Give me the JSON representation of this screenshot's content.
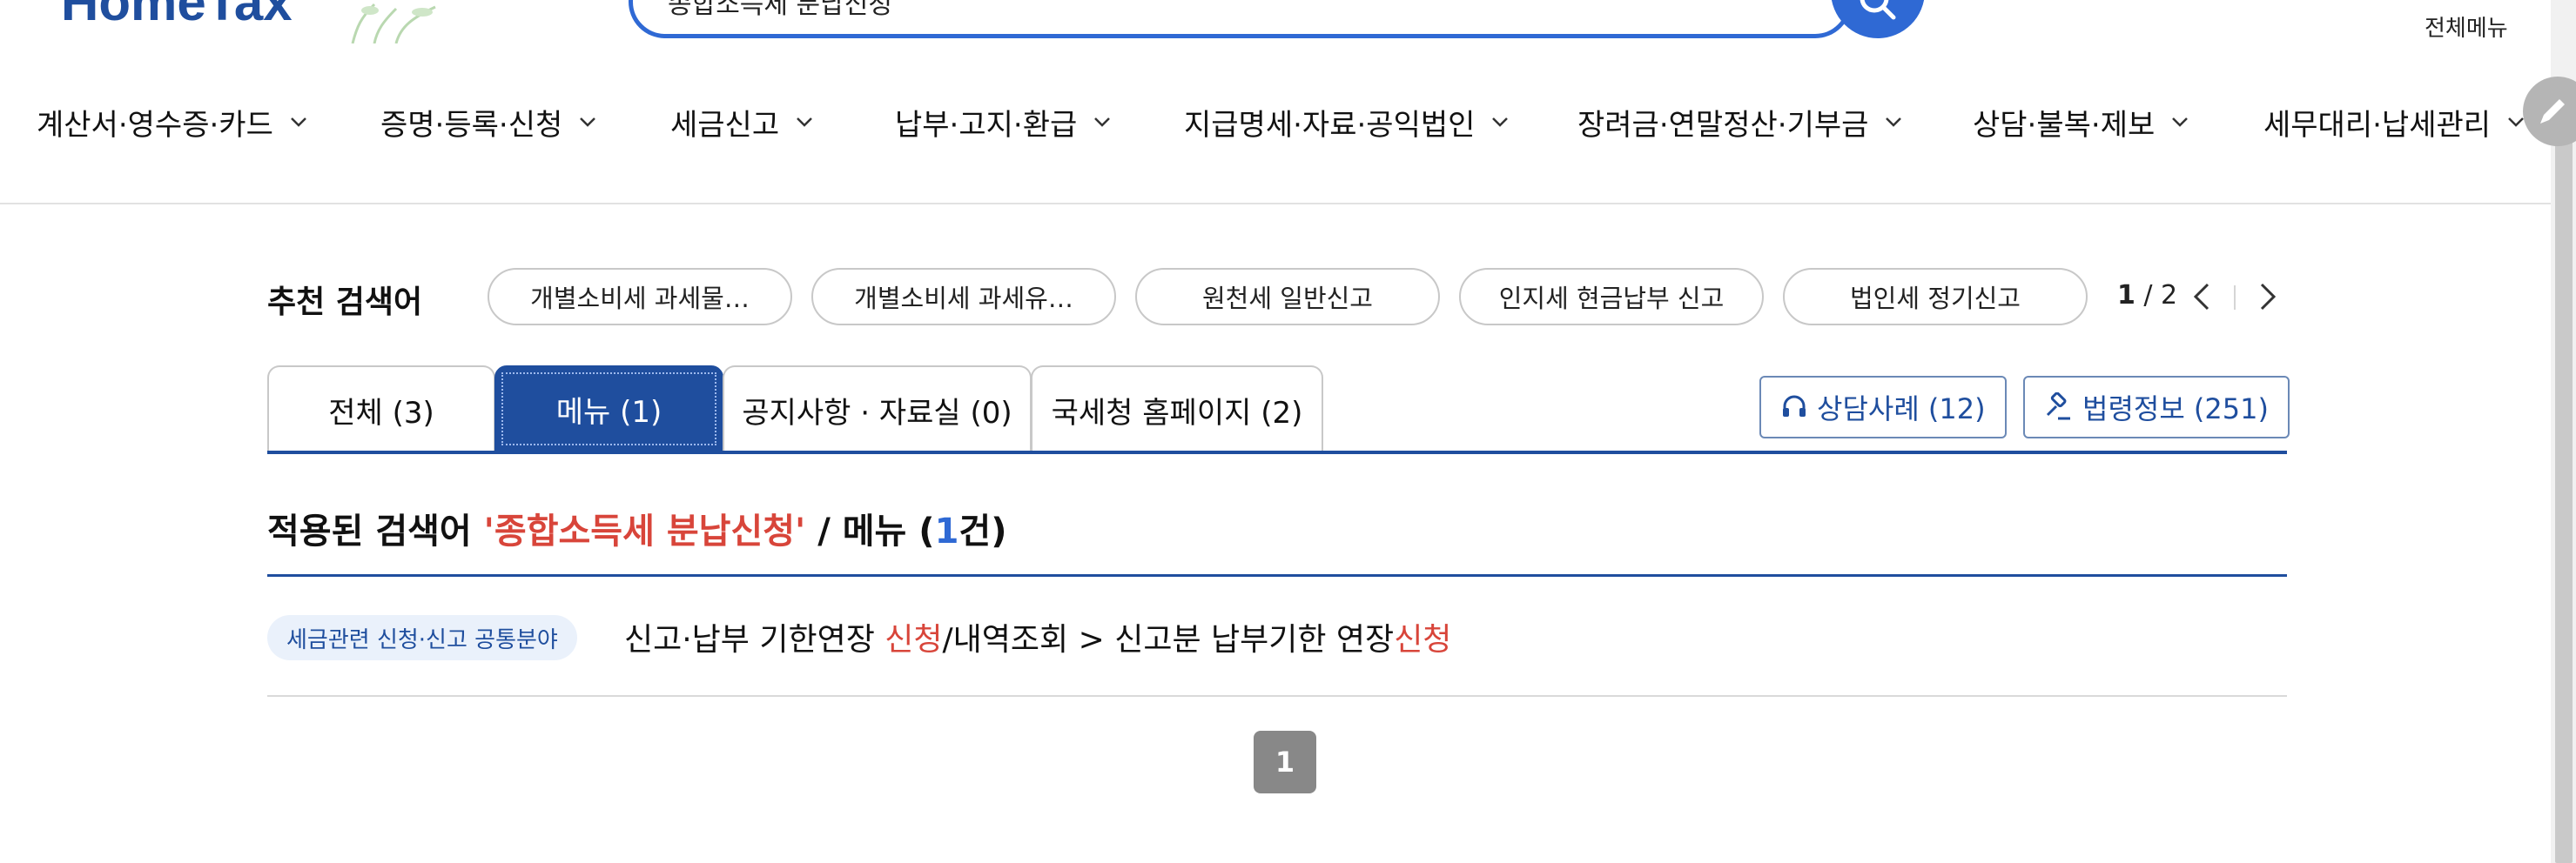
{
  "header": {
    "logo": "HomeTax",
    "search_value": "종합소득세 분납신청",
    "all_menu_label": "전체메뉴"
  },
  "gnb": {
    "items": [
      {
        "label": "계산서·영수증·카드"
      },
      {
        "label": "증명·등록·신청"
      },
      {
        "label": "세금신고"
      },
      {
        "label": "납부·고지·환급"
      },
      {
        "label": "지급명세·자료·공익법인"
      },
      {
        "label": "장려금·연말정산·기부금"
      },
      {
        "label": "상담·불복·제보"
      },
      {
        "label": "세무대리·납세관리"
      }
    ]
  },
  "recommended": {
    "title": "추천 검색어",
    "chips": [
      {
        "label": "개별소비세 과세물…"
      },
      {
        "label": "개별소비세 과세유…"
      },
      {
        "label": "원천세 일반신고"
      },
      {
        "label": "인지세 현금납부 신고"
      },
      {
        "label": "법인세 정기신고"
      }
    ],
    "page_current": "1",
    "page_total": " / 2"
  },
  "tabs": [
    {
      "label": "전체 (3)",
      "active": false
    },
    {
      "label": "메뉴 (1)",
      "active": true
    },
    {
      "label": "공지사항 · 자료실 (0)",
      "active": false
    },
    {
      "label": "국세청 홈페이지 (2)",
      "active": false
    }
  ],
  "side_buttons": {
    "consult": "상담사례 (12)",
    "law": "법령정보 (251)"
  },
  "result_heading": {
    "prefix": "적용된 검색어 ",
    "keyword": "'종합소득세 분납신청'",
    "middle": " / 메뉴 (",
    "count": "1",
    "suffix": "건)"
  },
  "results": [
    {
      "badge": "세금관련 신청·신고 공통분야",
      "part1": "신고·납부 기한연장 ",
      "hl1": "신청",
      "part2": "/내역조회 > 신고분 납부기한 연장",
      "hl2": "신청"
    }
  ],
  "pagination": {
    "current": "1"
  },
  "colors": {
    "brand_blue": "#1f4e9e",
    "search_blue": "#2f69d4",
    "highlight_red": "#d8453a"
  }
}
